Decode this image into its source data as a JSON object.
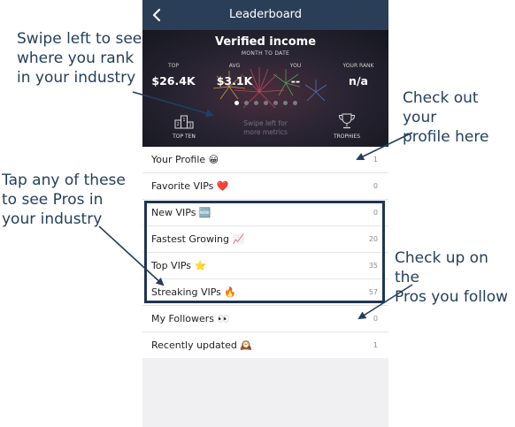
{
  "header": {
    "title": "Leaderboard",
    "back_icon": "chevron-left-icon"
  },
  "hero": {
    "title": "Verified income",
    "subtitle": "MONTH TO DATE",
    "stats": [
      {
        "label": "TOP",
        "value": "$26.4K"
      },
      {
        "label": "AVG",
        "value": "$3.1K"
      },
      {
        "label": "YOU",
        "value": "--"
      },
      {
        "label": "YOUR RANK",
        "value": "n/a"
      }
    ],
    "page_count": 7,
    "active_page": 1,
    "swipe_hint": "Swipe left for\nmore metrics",
    "top_ten_label": "TOP TEN",
    "trophies_label": "TROPHIES"
  },
  "list": [
    {
      "label": "Your Profile 😀",
      "count": "1"
    },
    {
      "label": "Favorite VIPs ❤️",
      "count": "0"
    },
    {
      "label": "New VIPs 🆕",
      "count": "0"
    },
    {
      "label": "Fastest Growing 📈",
      "count": "20"
    },
    {
      "label": "Top VIPs ⭐",
      "count": "35"
    },
    {
      "label": "Streaking VIPs 🔥",
      "count": "57"
    },
    {
      "label": "My Followers 👀",
      "count": "0"
    },
    {
      "label": "Recently updated 🕰️",
      "count": "1"
    }
  ],
  "annotations": {
    "swipe": "Swipe left to see\nwhere you rank\nin your industry",
    "profile": "Check out your\nprofile here",
    "pros": "Tap any of these\nto see Pros in\nyour industry",
    "follow": "Check up on the\nPros you follow"
  },
  "colors": {
    "navbar": "#2b3e57",
    "annotation_text": "#243f5c",
    "highlight_border": "#1f3552"
  }
}
